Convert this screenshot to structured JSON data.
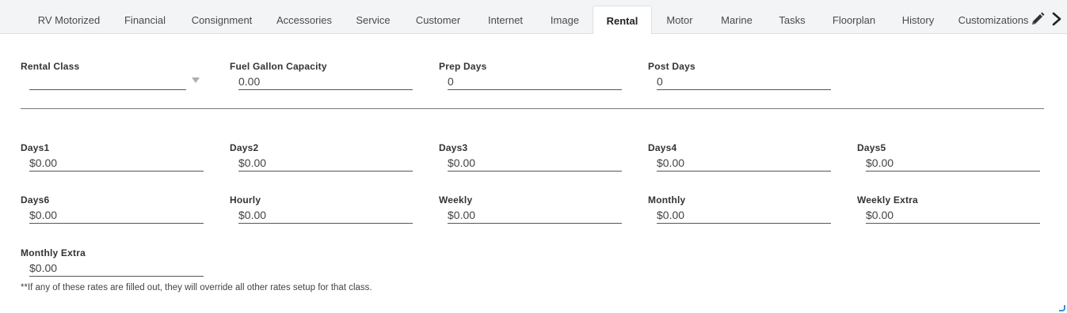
{
  "tabs": [
    {
      "label": "RV Motorized"
    },
    {
      "label": "Financial"
    },
    {
      "label": "Consignment"
    },
    {
      "label": "Accessories"
    },
    {
      "label": "Service"
    },
    {
      "label": "Customer"
    },
    {
      "label": "Internet"
    },
    {
      "label": "Image"
    },
    {
      "label": "Rental",
      "active": true
    },
    {
      "label": "Motor"
    },
    {
      "label": "Marine"
    },
    {
      "label": "Tasks"
    },
    {
      "label": "Floorplan"
    },
    {
      "label": "History"
    },
    {
      "label": "Customizations"
    }
  ],
  "icons": {
    "edit": "pencil-icon",
    "next": "chevron-right-icon",
    "dropdown": "triangle-down-icon"
  },
  "top_fields": {
    "rental_class": {
      "label": "Rental Class",
      "value": ""
    },
    "fuel_gallon_capacity": {
      "label": "Fuel Gallon Capacity",
      "value": "0.00"
    },
    "prep_days": {
      "label": "Prep Days",
      "value": "0"
    },
    "post_days": {
      "label": "Post Days",
      "value": "0"
    }
  },
  "rates": {
    "days1": {
      "label": "Days1",
      "value": "$0.00"
    },
    "days2": {
      "label": "Days2",
      "value": "$0.00"
    },
    "days3": {
      "label": "Days3",
      "value": "$0.00"
    },
    "days4": {
      "label": "Days4",
      "value": "$0.00"
    },
    "days5": {
      "label": "Days5",
      "value": "$0.00"
    },
    "days6": {
      "label": "Days6",
      "value": "$0.00"
    },
    "hourly": {
      "label": "Hourly",
      "value": "$0.00"
    },
    "weekly": {
      "label": "Weekly",
      "value": "$0.00"
    },
    "monthly": {
      "label": "Monthly",
      "value": "$0.00"
    },
    "weekly_extra": {
      "label": "Weekly Extra",
      "value": "$0.00"
    },
    "monthly_extra": {
      "label": "Monthly Extra",
      "value": "$0.00"
    }
  },
  "note": "**If any of these rates are filled out, they will override all other rates setup for that class.",
  "colors": {
    "accent": "#3a8fd8",
    "tabbar_bg": "#f2f4f5",
    "arrow": "#aab1a8"
  }
}
